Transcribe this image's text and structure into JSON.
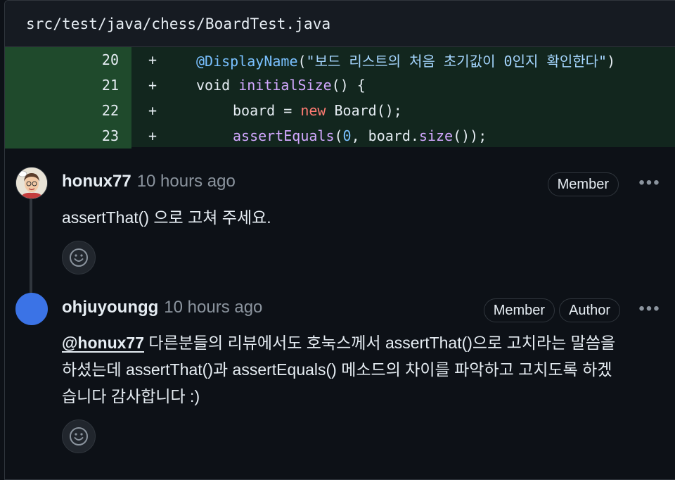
{
  "file": {
    "path": "src/test/java/chess/BoardTest.java"
  },
  "diff": {
    "lines": [
      {
        "num": "20",
        "marker": "+"
      },
      {
        "num": "21",
        "marker": "+"
      },
      {
        "num": "22",
        "marker": "+"
      },
      {
        "num": "23",
        "marker": "+"
      }
    ],
    "code": {
      "l20_ann": "@DisplayName",
      "l20_open": "(",
      "l20_str": "\"보드 리스트의 처음 초기값이 0인지 확인한다\"",
      "l20_close": ")",
      "l21_void": "void ",
      "l21_fn": "initialSize",
      "l21_rest": "() {",
      "l22_a": "board = ",
      "l22_new": "new",
      "l22_b": " Board();",
      "l23_fn": "assertEquals",
      "l23_open": "(",
      "l23_num": "0",
      "l23_mid": ", board.",
      "l23_fn2": "size",
      "l23_end": "());"
    }
  },
  "comments": [
    {
      "author": "honux77",
      "time": "10 hours ago",
      "badges": [
        "Member"
      ],
      "body": "assertThat() 으로 고쳐 주세요."
    },
    {
      "author": "ohjuyoungg",
      "time": "10 hours ago",
      "badges": [
        "Member",
        "Author"
      ],
      "mention": "@honux77",
      "body_line1": " 다른분들의 리뷰에서도 호눅스께서 assertThat()으로 고치라는 말씀을",
      "body_line2": "하셨는데 assertThat()과 assertEquals() 메소드의 차이를 파악하고 고치도록 하겠",
      "body_line3": "습니다 감사합니다 :)"
    }
  ],
  "ui": {
    "more_label": "•••"
  },
  "icons": {
    "reaction": "smiley-icon",
    "more": "kebab-horizontal-icon"
  },
  "colors": {
    "background": "#0d1117",
    "diff_add": "#12261e",
    "diff_gutter": "#1f4a2c",
    "avatar_oh": "#3b73e6"
  }
}
